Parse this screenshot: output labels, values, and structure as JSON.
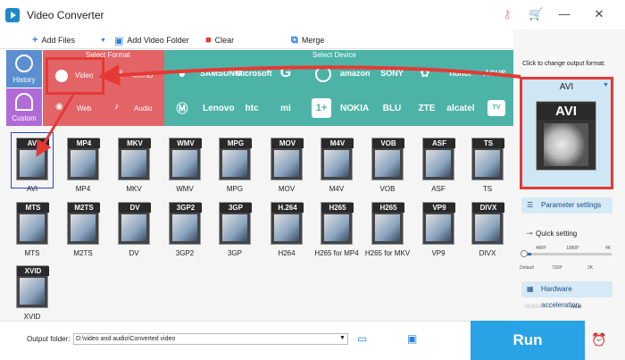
{
  "app": {
    "title": "Video Converter"
  },
  "toolbar": {
    "add_files": "Add Files",
    "add_video_folder": "Add Video Folder",
    "clear": "Clear",
    "merge": "Merge"
  },
  "left_nav": [
    {
      "label": "History",
      "icon": "clock-icon"
    },
    {
      "label": "Custom",
      "icon": "user-icon"
    }
  ],
  "sections": {
    "select_format": "Select Format",
    "select_device": "Select Device"
  },
  "format_tabs": [
    {
      "label": "Video"
    },
    {
      "label": "4K/HD"
    },
    {
      "label": "Web"
    },
    {
      "label": "Audio"
    }
  ],
  "devices_row1": [
    "SAMSUNG",
    "Microsoft",
    "G",
    "",
    "amazon",
    "SONY",
    "",
    "honor",
    "ASUS"
  ],
  "devices_row2": [
    "Lenovo",
    "htc",
    "mi",
    "",
    "NOKIA",
    "BLU",
    "ZTE",
    "alcatel",
    "TV"
  ],
  "formats": [
    {
      "tag": "AVI",
      "label": "AVI"
    },
    {
      "tag": "MP4",
      "label": "MP4"
    },
    {
      "tag": "MKV",
      "label": "MKV"
    },
    {
      "tag": "WMV",
      "label": "WMV"
    },
    {
      "tag": "MPG",
      "label": "MPG"
    },
    {
      "tag": "MOV",
      "label": "MOV"
    },
    {
      "tag": "M4V",
      "label": "M4V"
    },
    {
      "tag": "VOB",
      "label": "VOB"
    },
    {
      "tag": "ASF",
      "label": "ASF"
    },
    {
      "tag": "TS",
      "label": "TS"
    },
    {
      "tag": "MTS",
      "label": "MTS"
    },
    {
      "tag": "M2TS",
      "label": "M2TS"
    },
    {
      "tag": "DV",
      "label": "DV"
    },
    {
      "tag": "3GP2",
      "label": "3GP2"
    },
    {
      "tag": "3GP",
      "label": "3GP"
    },
    {
      "tag": "H.264",
      "label": "H264"
    },
    {
      "tag": "H265",
      "label": "H265 for MP4"
    },
    {
      "tag": "H265",
      "label": "H265 for MKV"
    },
    {
      "tag": "VP9",
      "label": "VP9"
    },
    {
      "tag": "DIVX",
      "label": "DIVX"
    },
    {
      "tag": "XVID",
      "label": "XVID"
    }
  ],
  "bottom": {
    "output_folder_label": "Output folder:",
    "output_path": "D:\\video and audio\\Converted video"
  },
  "right_panel": {
    "click_to_change": "Click to change output format:",
    "output_format": "AVI",
    "params_button": "Parameter settings",
    "quick_setting": "Quick setting",
    "quality_ticks_top": [
      "480P",
      "1080P",
      "4K"
    ],
    "quality_ticks_bottom": [
      "Default",
      "720P",
      "2K"
    ],
    "hw_button": "Hardware acceleration",
    "nvidia": "NVIDIA",
    "intel": "Intel",
    "run_button": "Run"
  },
  "colors": {
    "accent": "#2aa3e6",
    "format_strip": "#e26466",
    "device_strip": "#4db3a7",
    "annotation": "#e53935"
  }
}
